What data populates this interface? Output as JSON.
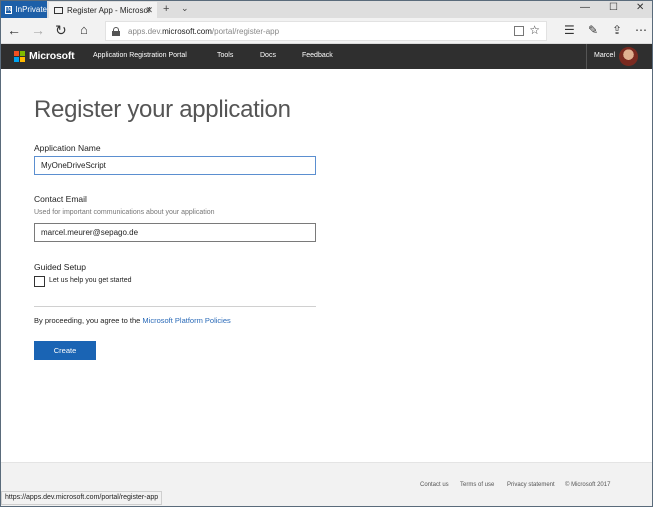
{
  "browser": {
    "inprivate_label": "InPrivate",
    "tab_title": "Register App - Microsof",
    "tab_close": "✕",
    "new_tab": "+",
    "tab_list": "⌄",
    "url_domain": "apps.dev.",
    "url_host": "microsoft.com",
    "url_path": "/portal/register-app",
    "status_url": "https://apps.dev.microsoft.com/portal/register-app",
    "window_controls": [
      "—",
      "☐",
      "✕"
    ]
  },
  "header": {
    "brand": "Microsoft",
    "logo_colors": [
      "#f25022",
      "#7fba00",
      "#00a4ef",
      "#ffb900"
    ],
    "nav": [
      "Application Registration Portal",
      "Tools",
      "Docs",
      "Feedback"
    ],
    "user_name": "Marcel"
  },
  "form": {
    "title": "Register your application",
    "app_name_label": "Application Name",
    "app_name_value": "MyOneDriveScript",
    "email_label": "Contact Email",
    "email_hint": "Used for important communications about your application",
    "email_value": "marcel.meurer@sepago.de",
    "guided_label": "Guided Setup",
    "guided_checkbox_label": "Let us help you get started",
    "guided_checked": false,
    "terms_prefix": "By proceeding, you agree to the ",
    "terms_link": "Microsoft Platform Policies",
    "create_label": "Create"
  },
  "footer": {
    "links": [
      "Contact us",
      "Terms of use",
      "Privacy statement"
    ],
    "copyright": "© Microsoft 2017"
  },
  "colors": {
    "accent": "#1a64b4",
    "header_bg": "#2f2f2f",
    "link": "#2a6ab8"
  }
}
